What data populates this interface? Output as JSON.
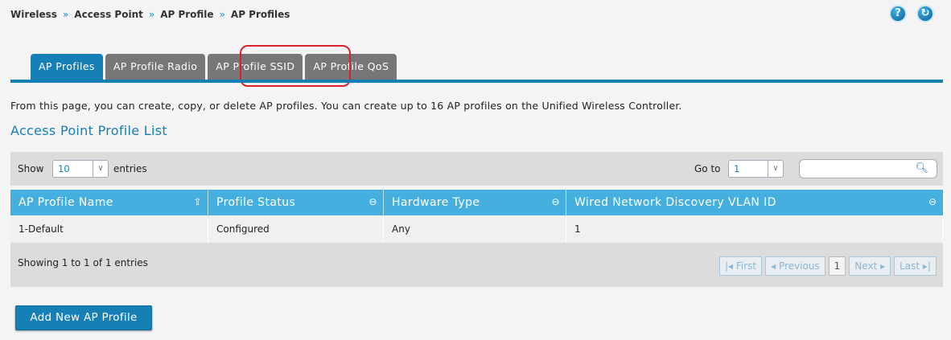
{
  "breadcrumb": {
    "items": [
      "Wireless",
      "Access Point",
      "AP Profile",
      "AP Profiles"
    ],
    "separator": "»"
  },
  "header_icons": {
    "help": "?",
    "refresh": "↻"
  },
  "tabs": [
    {
      "label": "AP Profiles",
      "active": true
    },
    {
      "label": "AP Profile Radio",
      "active": false
    },
    {
      "label": "AP Profile SSID",
      "active": false,
      "highlighted": true
    },
    {
      "label": "AP Profile QoS",
      "active": false
    }
  ],
  "description": "From this page, you can create, copy, or delete AP profiles. You can create up to 16 AP profiles on the Unified Wireless Controller.",
  "section_title": "Access Point Profile List",
  "toolbar": {
    "show_label": "Show",
    "entries_value": "10",
    "entries_label": "entries",
    "goto_label": "Go to",
    "goto_value": "1",
    "search_value": ""
  },
  "table": {
    "columns": [
      "AP Profile Name",
      "Profile Status",
      "Hardware Type",
      "Wired Network Discovery VLAN ID"
    ],
    "rows": [
      [
        "1-Default",
        "Configured",
        "Any",
        "1"
      ]
    ]
  },
  "footer": {
    "info": "Showing 1 to 1 of 1 entries",
    "pager": {
      "first": "First",
      "previous": "Previous",
      "current": "1",
      "next": "Next",
      "last": "Last"
    }
  },
  "add_button": "Add New AP Profile",
  "colors": {
    "accent": "#167fb5",
    "header": "#45afdf",
    "highlight": "#d8232a",
    "tab_inactive": "#777777"
  }
}
